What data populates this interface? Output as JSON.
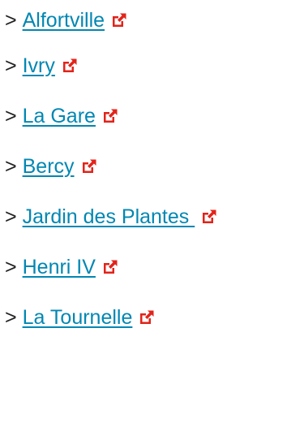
{
  "links": [
    {
      "prefix": ">",
      "label": "Alfortville",
      "icon": "external-link-icon"
    },
    {
      "prefix": ">",
      "label": "Ivry",
      "icon": "external-link-icon"
    },
    {
      "prefix": ">",
      "label": "La Gare",
      "icon": "external-link-icon"
    },
    {
      "prefix": ">",
      "label": "Bercy",
      "icon": "external-link-icon"
    },
    {
      "prefix": ">",
      "label": "Jardin des Plantes ",
      "icon": "external-link-icon"
    },
    {
      "prefix": ">",
      "label": "Henri IV",
      "icon": "external-link-icon"
    },
    {
      "prefix": ">",
      "label": "La Tournelle",
      "icon": "external-link-icon"
    }
  ],
  "colors": {
    "link": "#0087b3",
    "text": "#222222",
    "icon": "#e2231a"
  }
}
